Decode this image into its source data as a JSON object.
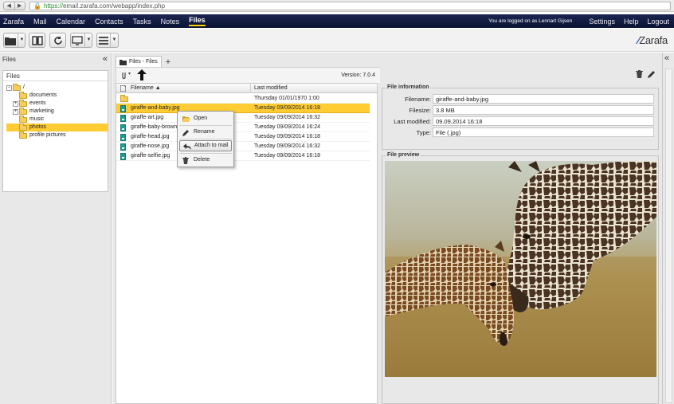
{
  "browser": {
    "url_scheme": "https://",
    "url_rest": "email.zarafa.com/webapp/index.php"
  },
  "topnav": {
    "tabs": [
      "Zarafa",
      "Mail",
      "Calendar",
      "Contacts",
      "Tasks",
      "Notes",
      "Files"
    ],
    "active_tab": "Files",
    "logon_text": "You are logged on as Lennart Gijsen",
    "links": [
      "Settings",
      "Help",
      "Logout"
    ]
  },
  "brand": {
    "name": "Zarafa"
  },
  "left_panel": {
    "title": "Files",
    "tree_title": "Files",
    "tree": [
      {
        "label": "/",
        "expander": "−",
        "indent": 0
      },
      {
        "label": "documents",
        "expander": "",
        "indent": 1
      },
      {
        "label": "events",
        "expander": "+",
        "indent": 1
      },
      {
        "label": "marketing",
        "expander": "+",
        "indent": 1
      },
      {
        "label": "music",
        "expander": "",
        "indent": 1
      },
      {
        "label": "photos",
        "expander": "",
        "indent": 1,
        "selected": true
      },
      {
        "label": "profile pictures",
        "expander": "",
        "indent": 1
      }
    ]
  },
  "middle_panel": {
    "tab_label": "Files - Files",
    "version": "Version: 7.0.4",
    "columns": {
      "filename": "Filename ▲",
      "modified": "Last modified"
    },
    "rows": [
      {
        "name": "",
        "modified": "Thursday 01/01/1970 1:00",
        "type": "folder"
      },
      {
        "name": "giraffe-and-baby.jpg",
        "modified": "Tuesday 09/09/2014 16:18",
        "type": "image",
        "selected": true
      },
      {
        "name": "giraffe-art.jpg",
        "modified": "Tuesday 09/09/2014 16:32",
        "type": "image"
      },
      {
        "name": "giraffe-baby-brown.jpg",
        "modified": "Tuesday 09/09/2014 16:24",
        "type": "image"
      },
      {
        "name": "giraffe-head.jpg",
        "modified": "Tuesday 09/09/2014 16:18",
        "type": "image"
      },
      {
        "name": "giraffe-nose.jpg",
        "modified": "Tuesday 09/09/2014 16:32",
        "type": "image"
      },
      {
        "name": "giraffe-selfie.jpg",
        "modified": "Tuesday 09/09/2014 16:18",
        "type": "image"
      }
    ]
  },
  "context_menu": {
    "items": [
      "Open",
      "Rename",
      "Attach to mail",
      "Delete"
    ],
    "hovered": "Attach to mail"
  },
  "file_info": {
    "legend": "File information",
    "fields": [
      {
        "label": "Filename:",
        "value": "giraffe-and-baby.jpg"
      },
      {
        "label": "Filesize:",
        "value": "3.8 MB"
      },
      {
        "label": "Last modified:",
        "value": "09.09.2014 16:18"
      },
      {
        "label": "Type:",
        "value": "File (.jpg)"
      }
    ]
  },
  "preview": {
    "legend": "File preview"
  },
  "colors": {
    "nav_bg": "#0b1434",
    "selection": "#ffcc33",
    "active_tab_underline": "#ffcc00"
  }
}
